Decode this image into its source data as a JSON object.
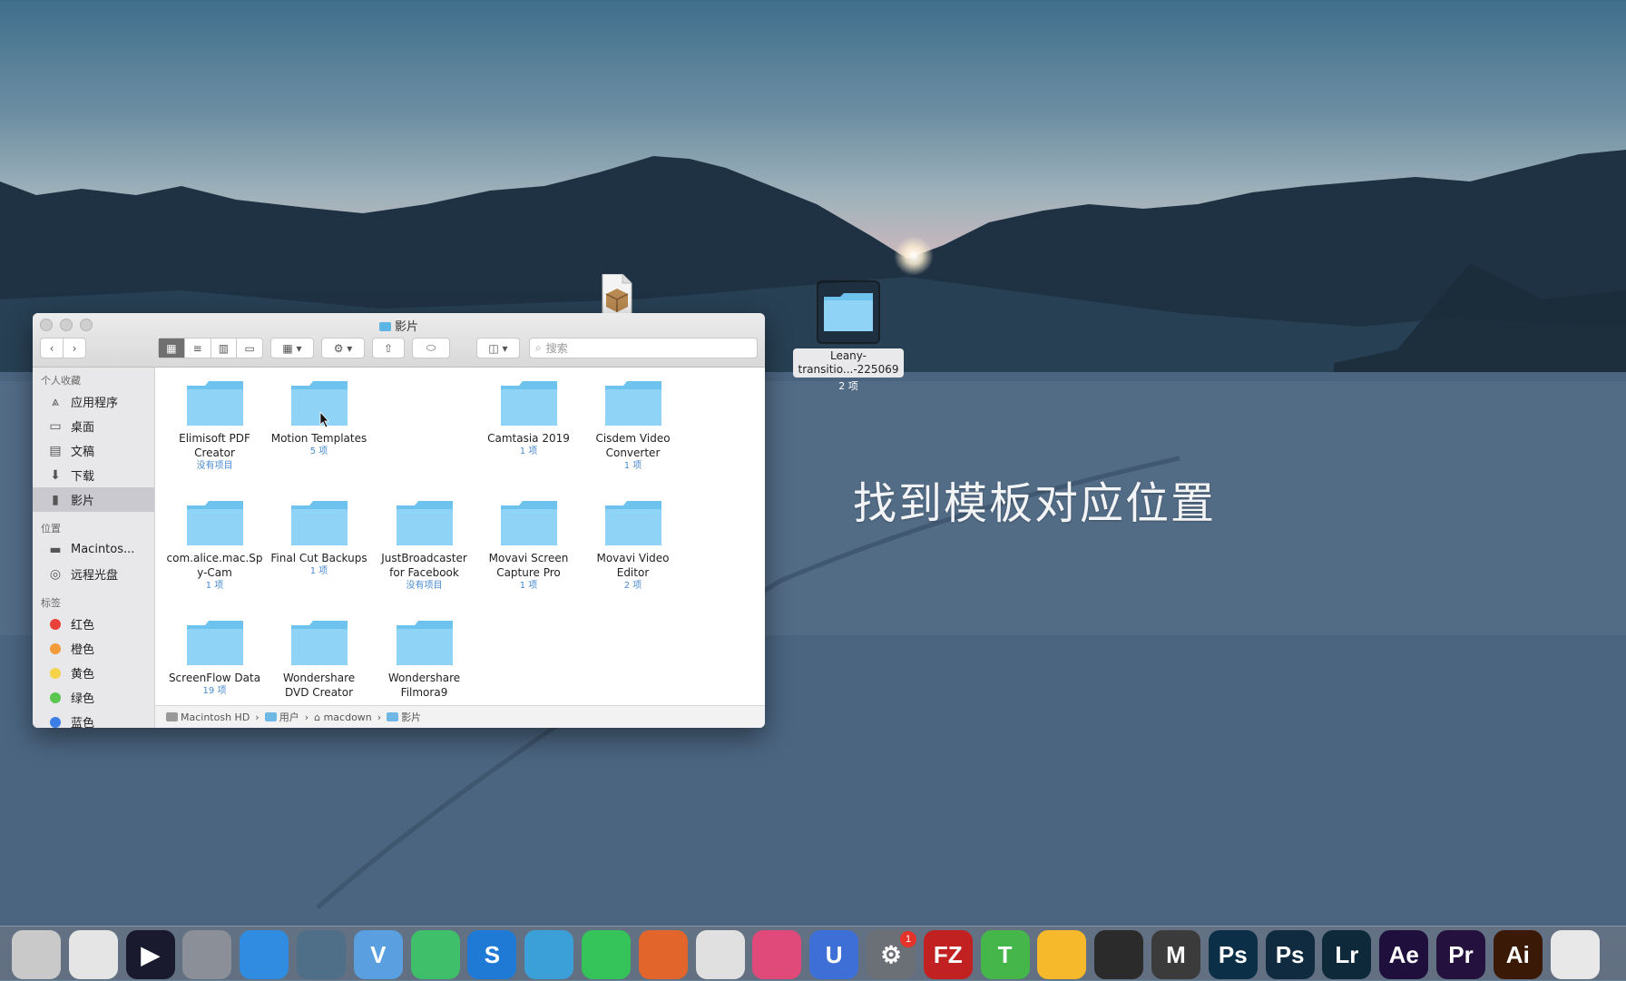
{
  "overlay_caption": "找到模板对应位置",
  "desktop": {
    "folder_label_line1": "Leany-",
    "folder_label_line2": "transitio...-225069",
    "folder_count": "2 项"
  },
  "finder": {
    "title": "影片",
    "search_placeholder": "搜索",
    "sidebar": {
      "favorites_header": "个人收藏",
      "favorites": [
        {
          "label": "应用程序",
          "icon": "applications-icon"
        },
        {
          "label": "桌面",
          "icon": "desktop-icon"
        },
        {
          "label": "文稿",
          "icon": "documents-icon"
        },
        {
          "label": "下载",
          "icon": "downloads-icon"
        },
        {
          "label": "影片",
          "icon": "movies-icon"
        }
      ],
      "locations_header": "位置",
      "locations": [
        {
          "label": "Macintos...",
          "icon": "hard-drive-icon"
        },
        {
          "label": "远程光盘",
          "icon": "remote-disc-icon"
        }
      ],
      "tags_header": "标签",
      "tags": [
        {
          "label": "红色",
          "color": "#e9423d"
        },
        {
          "label": "橙色",
          "color": "#f39a3a"
        },
        {
          "label": "黄色",
          "color": "#f5d34a"
        },
        {
          "label": "绿色",
          "color": "#59c74f"
        },
        {
          "label": "蓝色",
          "color": "#3d7de6"
        }
      ]
    },
    "items": [
      {
        "name1": "Elimisoft PDF",
        "name2": "Creator",
        "count": "没有项目"
      },
      {
        "name1": "Motion Templates",
        "name2": "",
        "count": "5 项"
      },
      {
        "name1": "Camtasia 2019",
        "name2": "",
        "count": "1 项"
      },
      {
        "name1": "Cisdem Video",
        "name2": "Converter",
        "count": "1 项"
      },
      {
        "name1": "com.alice.mac.Sp",
        "name2": "y-Cam",
        "count": "1 项"
      },
      {
        "name1": "Final Cut Backups",
        "name2": "",
        "count": "1 项"
      },
      {
        "name1": "JustBroadcaster",
        "name2": "for Facebook",
        "count": "没有项目"
      },
      {
        "name1": "Movavi Screen",
        "name2": "Capture Pro",
        "count": "1 项"
      },
      {
        "name1": "Movavi Video",
        "name2": "Editor",
        "count": "2 项"
      },
      {
        "name1": "ScreenFlow Data",
        "name2": "",
        "count": "19 项"
      },
      {
        "name1": "Wondershare",
        "name2": "DVD Creator",
        "count": ""
      },
      {
        "name1": "Wondershare",
        "name2": "Filmora9",
        "count": ""
      }
    ],
    "pathbar": [
      "Macintosh HD",
      "用户",
      "macdown",
      "影片"
    ],
    "path_separator": "›"
  },
  "dock": {
    "badge_count": "1",
    "apps": [
      {
        "name": "photo-booth",
        "label": "",
        "bg": "#c9c9c9"
      },
      {
        "name": "screen-recorder",
        "label": "",
        "bg": "#e5e5e5"
      },
      {
        "name": "video-player",
        "label": "▶",
        "bg": "#1a1a2e"
      },
      {
        "name": "launchpad",
        "label": "",
        "bg": "#8a8f98"
      },
      {
        "name": "safari",
        "label": "",
        "bg": "#2f8ce0"
      },
      {
        "name": "hexagon-app",
        "label": "",
        "bg": "#4f6f88"
      },
      {
        "name": "vectorize-app",
        "label": "V",
        "bg": "#5aa0e0"
      },
      {
        "name": "image-app",
        "label": "",
        "bg": "#3fbf6a"
      },
      {
        "name": "s-app",
        "label": "S",
        "bg": "#1f7ad6"
      },
      {
        "name": "quicktime",
        "label": "",
        "bg": "#3ba0d8"
      },
      {
        "name": "wechat",
        "label": "",
        "bg": "#34c45a"
      },
      {
        "name": "firefox",
        "label": "",
        "bg": "#e2662c"
      },
      {
        "name": "chrome",
        "label": "",
        "bg": "#e0e0e0"
      },
      {
        "name": "color-app",
        "label": "",
        "bg": "#e04a7a"
      },
      {
        "name": "magnet-app",
        "label": "U",
        "bg": "#3d6fd6"
      },
      {
        "name": "system-preferences",
        "label": "⚙",
        "bg": "#6b6f76"
      },
      {
        "name": "filezilla",
        "label": "FZ",
        "bg": "#c22121"
      },
      {
        "name": "typora",
        "label": "T",
        "bg": "#45b649"
      },
      {
        "name": "sketch",
        "label": "",
        "bg": "#f6b92b"
      },
      {
        "name": "final-cut-pro",
        "label": "",
        "bg": "#2b2b2b"
      },
      {
        "name": "m-app",
        "label": "M",
        "bg": "#3b3b3b"
      },
      {
        "name": "photoshop",
        "label": "Ps",
        "bg": "#0b2f47"
      },
      {
        "name": "photoshop-2",
        "label": "Ps",
        "bg": "#102a40"
      },
      {
        "name": "lightroom",
        "label": "Lr",
        "bg": "#0e2a3a"
      },
      {
        "name": "after-effects",
        "label": "Ae",
        "bg": "#1f0f3d"
      },
      {
        "name": "premiere",
        "label": "Pr",
        "bg": "#25113d"
      },
      {
        "name": "illustrator",
        "label": "Ai",
        "bg": "#3a1a06"
      },
      {
        "name": "qq",
        "label": "",
        "bg": "#e8e8e8"
      }
    ]
  }
}
